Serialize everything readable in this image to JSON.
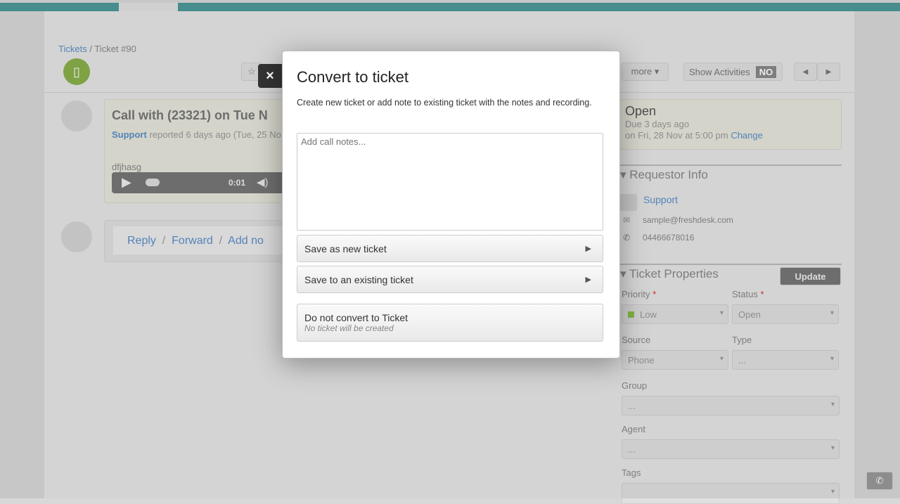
{
  "breadcrumb": {
    "root": "Tickets",
    "separator": "/",
    "current": "Ticket #90"
  },
  "toolbar": {
    "more": "more ▾",
    "show_activities": "Show Activities",
    "toggle": "NO",
    "prev": "◀",
    "next": "▶"
  },
  "ticket": {
    "title": "Call with (23321) on Tue N",
    "requester": "Support",
    "reported": "reported 6 days ago (Tue, 25 No",
    "note": "dfjhasg",
    "audio_time": "0:01"
  },
  "reply_bar": {
    "reply": "Reply",
    "forward": "Forward",
    "add_note": "Add no"
  },
  "status_card": {
    "status": "Open",
    "due": "Due 3 days ago",
    "due_date": "on Fri, 28 Nov at 5:00 pm",
    "change": "Change"
  },
  "requestor": {
    "heading": "Requestor Info",
    "name": "Support",
    "email": "sample@freshdesk.com",
    "phone": "04466678016"
  },
  "properties": {
    "heading": "Ticket Properties",
    "update": "Update",
    "priority_label": "Priority",
    "priority": "Low",
    "status_label": "Status",
    "status": "Open",
    "source_label": "Source",
    "source": "Phone",
    "type_label": "Type",
    "type": "...",
    "group_label": "Group",
    "group": "...",
    "agent_label": "Agent",
    "agent": "...",
    "tags_label": "Tags",
    "required": "*"
  },
  "modal": {
    "title": "Convert to ticket",
    "close": "×",
    "description": "Create new ticket or add note to existing ticket with the notes and recording.",
    "notes_placeholder": "Add call notes...",
    "save_new": "Save as new ticket",
    "save_existing": "Save to an existing ticket",
    "no_convert": "Do not convert to Ticket",
    "no_convert_sub": "No ticket will be created"
  },
  "colors": {
    "link": "#5a8fc8",
    "priority_low": "#8bc34a",
    "topbar": "#4e9a9a"
  }
}
